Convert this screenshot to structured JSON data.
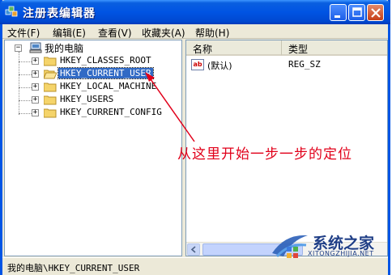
{
  "window": {
    "title": "注册表编辑器"
  },
  "menu": [
    {
      "label": "文件(F)"
    },
    {
      "label": "编辑(E)"
    },
    {
      "label": "查看(V)"
    },
    {
      "label": "收藏夹(A)"
    },
    {
      "label": "帮助(H)"
    }
  ],
  "tree": {
    "root": "我的电脑",
    "items": [
      {
        "label": "HKEY_CLASSES_ROOT",
        "selected": false
      },
      {
        "label": "HKEY_CURRENT_USER",
        "selected": true
      },
      {
        "label": "HKEY_LOCAL_MACHINE",
        "selected": false
      },
      {
        "label": "HKEY_USERS",
        "selected": false
      },
      {
        "label": "HKEY_CURRENT_CONFIG",
        "selected": false
      }
    ]
  },
  "list": {
    "columns": [
      {
        "label": "名称"
      },
      {
        "label": "类型"
      }
    ],
    "rows": [
      {
        "name": "(默认)",
        "type": "REG_SZ",
        "icon": "ab"
      }
    ]
  },
  "status": {
    "path": "我的电脑\\HKEY_CURRENT_USER"
  },
  "annotation": {
    "text": "从这里开始一步一步的定位",
    "color": "#e1001a"
  },
  "watermark": {
    "title": "系统之家",
    "subtitle": "XITONGZHIJIA.NET"
  },
  "colors": {
    "titlebar": "#0054e3",
    "selection": "#316ac5",
    "window_bg": "#ece9d8"
  }
}
